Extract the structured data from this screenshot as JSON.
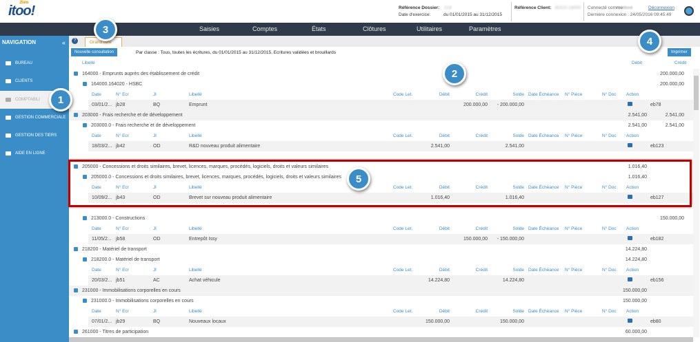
{
  "header": {
    "logo_text": "itoo!",
    "logo_badge": "15 ans",
    "ref_dossier_label": "Référence Dossier:",
    "ref_dossier_value": "219",
    "date_exercice_label": "Date d'exercice:",
    "date_exercice_value": "du 01/01/2015 au 31/12/2015",
    "ref_client_label": "Référence Client:",
    "ref_client_value": "35320-18000",
    "connected_label": "Connecté comme",
    "connected_user": "rootitool",
    "logout": "Déconnexion",
    "last_login": "Dernière connexion : 24/05/2016 09:45:49"
  },
  "nav": [
    "Saisies",
    "Comptes",
    "États",
    "Clôtures",
    "Utilitaires",
    "Paramètres"
  ],
  "sidebar": {
    "title": "NAVIGATION",
    "collapse": "«",
    "items": [
      "BUREAU",
      "CLIENTS",
      "COMPTABILI",
      "GESTION COMMERCIALE",
      "GESTION DES TIERS",
      "AIDE EN LIGNE"
    ],
    "active": 2
  },
  "tabs": {
    "help": "?",
    "active_tab": "Grand livre"
  },
  "toolbar": {
    "new_button": "Nouvelle consultation",
    "filter": "Par classe : Tous, toutes les écritures, du 01/01/2015 au 31/12/2015, Ecritures validées et brouillards",
    "print_button": "Imprimer"
  },
  "top_headers": {
    "libelle": "Libellé",
    "debit": "Débit",
    "credit": "Crédit"
  },
  "columns": [
    "Date",
    "N° Ecr",
    "Jl",
    "Libellé",
    "Code Let.",
    "Débit",
    "Crédit",
    "Solde",
    "Date Échéance",
    "N° Pièce",
    "N° Doc",
    "Action"
  ],
  "accounts": [
    {
      "label": "164000 - Emprunts auprès des établissement de crédit",
      "debit": "",
      "credit": "200.000,00",
      "sub": {
        "label": "164000.164020 - HSBC",
        "debit": "",
        "credit": "200.000,00",
        "entry": {
          "date": "03/01/2...",
          "ecr": "jb28",
          "jl": "BQ",
          "libelle": "Emprunt",
          "debit": "",
          "credit": "200.000,00",
          "solde": "- 200.000,00",
          "ref": "eb78"
        }
      }
    },
    {
      "label": "203000 - Frais recherche et de développement",
      "debit": "2.541,00",
      "credit": "2.541,00",
      "sub": {
        "label": "203000.0 - Frais recherche et de développement",
        "debit": "2.541,00",
        "credit": "2.541,00",
        "entry": {
          "date": "18/03/2...",
          "ecr": "jb42",
          "jl": "OD",
          "libelle": "R&D nouveau produit alimentaire",
          "debit": "2.541,00",
          "credit": "",
          "solde": "2.541,00",
          "ref": "eb123"
        }
      }
    },
    {
      "label": "205000 - Concessions et droits similaires, brevet, licences, marques, procédés, logiciels, droits et valeurs similaires",
      "debit": "1.016,40",
      "credit": "",
      "sub": {
        "label": "205000.0 - Concessions et droits similaires, brevet, licences, marques, procédés, logiciels, droits et valeurs similaires",
        "debit": "1.016,40",
        "credit": "",
        "entry": {
          "date": "10/09/2...",
          "ecr": "jb43",
          "jl": "OD",
          "libelle": "Brevet sur nouveau produit alimentaire",
          "debit": "1.016,40",
          "credit": "",
          "solde": "1.016,40",
          "ref": "eb127"
        }
      }
    },
    {
      "label": "",
      "debit": "",
      "credit": "",
      "sub": {
        "label": "213000.0 - Constructions",
        "debit": "",
        "credit": "150.000,00",
        "entry": {
          "date": "11/05/2...",
          "ecr": "jb58",
          "jl": "OD",
          "libelle": "Entrepôt Issy",
          "debit": "",
          "credit": "150.000,00",
          "solde": "- 150.000,00",
          "ref": "eb182"
        }
      }
    },
    {
      "label": "218200 - Matériel de transport",
      "debit": "14.224,80",
      "credit": "",
      "sub": {
        "label": "218200.0 - Matériel de transport",
        "debit": "14.224,80",
        "credit": "",
        "entry": {
          "date": "20/03/2...",
          "ecr": "jb51",
          "jl": "AC",
          "libelle": "Achat véhicule",
          "debit": "14.224,80",
          "credit": "",
          "solde": "14.224,80",
          "ref": "eb156"
        }
      }
    },
    {
      "label": "231000 - Immobilisations corporelles en cours",
      "debit": "150.000,00",
      "credit": "",
      "sub": {
        "label": "231000.0 - Immobilisations corporelles en cours",
        "debit": "150.000,00",
        "credit": "",
        "entry": {
          "date": "07/01/2...",
          "ecr": "jb29",
          "jl": "BQ",
          "libelle": "Nouveaux locaux",
          "debit": "150.000,00",
          "credit": "",
          "solde": "150.000,00",
          "ref": "eb80"
        }
      }
    },
    {
      "label": "261000 - Titres de participation",
      "debit": "60.000,00",
      "credit": "",
      "sub": null
    }
  ],
  "annotations": [
    "1",
    "2",
    "3",
    "4",
    "5"
  ],
  "colors": {
    "accent": "#3a8dc6",
    "nav": "#2f3a4a",
    "highlight": "#c00000"
  }
}
